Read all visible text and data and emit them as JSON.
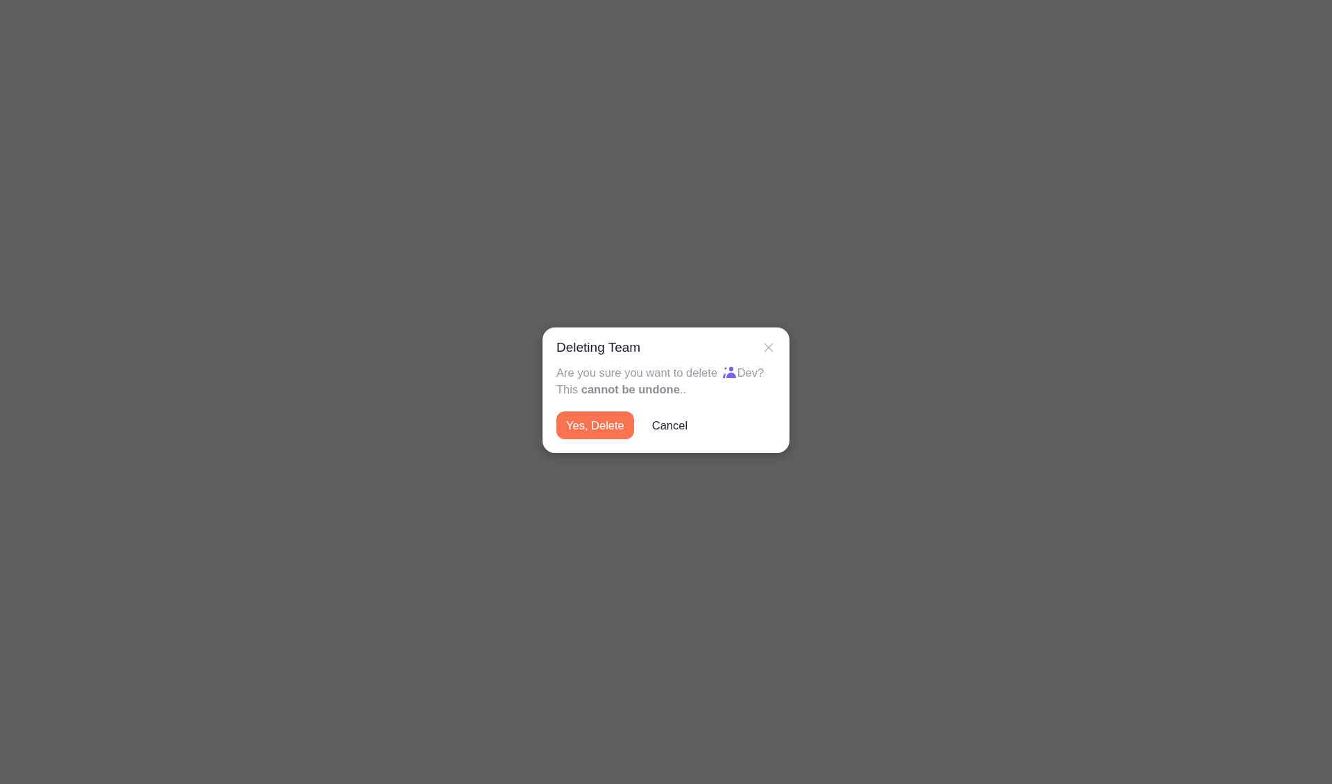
{
  "dialog": {
    "title": "Deleting Team",
    "message_start": "Are you sure you want to delete",
    "team_name": "Dev",
    "message_end": "? This **cannot be undone**..",
    "buttons": [
      {
        "label": "Yes, Delete",
        "kind": "danger"
      },
      {
        "label": "Cancel",
        "kind": "plain"
      }
    ]
  }
}
